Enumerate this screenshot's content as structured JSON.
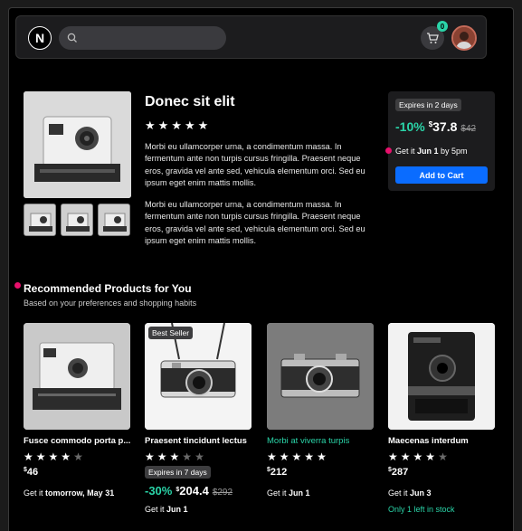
{
  "header": {
    "logo_letter": "N",
    "cart_count": "0"
  },
  "product": {
    "title": "Donec sit elit",
    "rating": 5,
    "description_1": "Morbi eu ullamcorper urna, a condimentum massa. In fermentum ante non turpis cursus fringilla. Praesent neque eros, gravida vel ante sed, vehicula elementum orci. Sed eu ipsum eget enim mattis mollis.",
    "description_2": "Morbi eu ullamcorper urna, a condimentum massa. In fermentum ante non turpis cursus fringilla. Praesent neque eros, gravida vel ante sed, vehicula elementum orci. Sed eu ipsum eget enim mattis mollis."
  },
  "buybox": {
    "expires": "Expires in 2 days",
    "discount": "-10%",
    "currency": "$",
    "price": "37.8",
    "old_price": "$42",
    "delivery_prefix": "Get it ",
    "delivery_date": "Jun 1",
    "delivery_suffix": " by 5pm",
    "add_to_cart": "Add to Cart"
  },
  "recommended": {
    "title": "Recommended Products for You",
    "subtitle": "Based on your preferences and shopping habits",
    "items": [
      {
        "name": "Fusce commodo porta p...",
        "rating": 4,
        "currency": "$",
        "price": "46",
        "delivery_prefix": "Get it ",
        "delivery_date": "tomorrow, May 31"
      },
      {
        "badge": "Best Seller",
        "name": "Praesent tincidunt lectus",
        "rating": 3,
        "expires": "Expires in 7 days",
        "discount": "-30%",
        "currency": "$",
        "price": "204.4",
        "old_price": "$292",
        "delivery_prefix": "Get it ",
        "delivery_date": "Jun 1"
      },
      {
        "name": "Morbi at viverra turpis",
        "rating": 5,
        "currency": "$",
        "price": "212",
        "delivery_prefix": "Get it ",
        "delivery_date": "Jun 1"
      },
      {
        "name": "Maecenas interdum",
        "rating": 4,
        "currency": "$",
        "price": "287",
        "delivery_prefix": "Get it ",
        "delivery_date": "Jun 3",
        "stock": "Only 1 left in stock"
      }
    ]
  },
  "colors": {
    "accent_green": "#2ad4a8",
    "button_blue": "#0a6cff",
    "marker_pink": "#e8106c"
  },
  "icons": [
    "search-icon",
    "cart-icon",
    "star-icon"
  ]
}
